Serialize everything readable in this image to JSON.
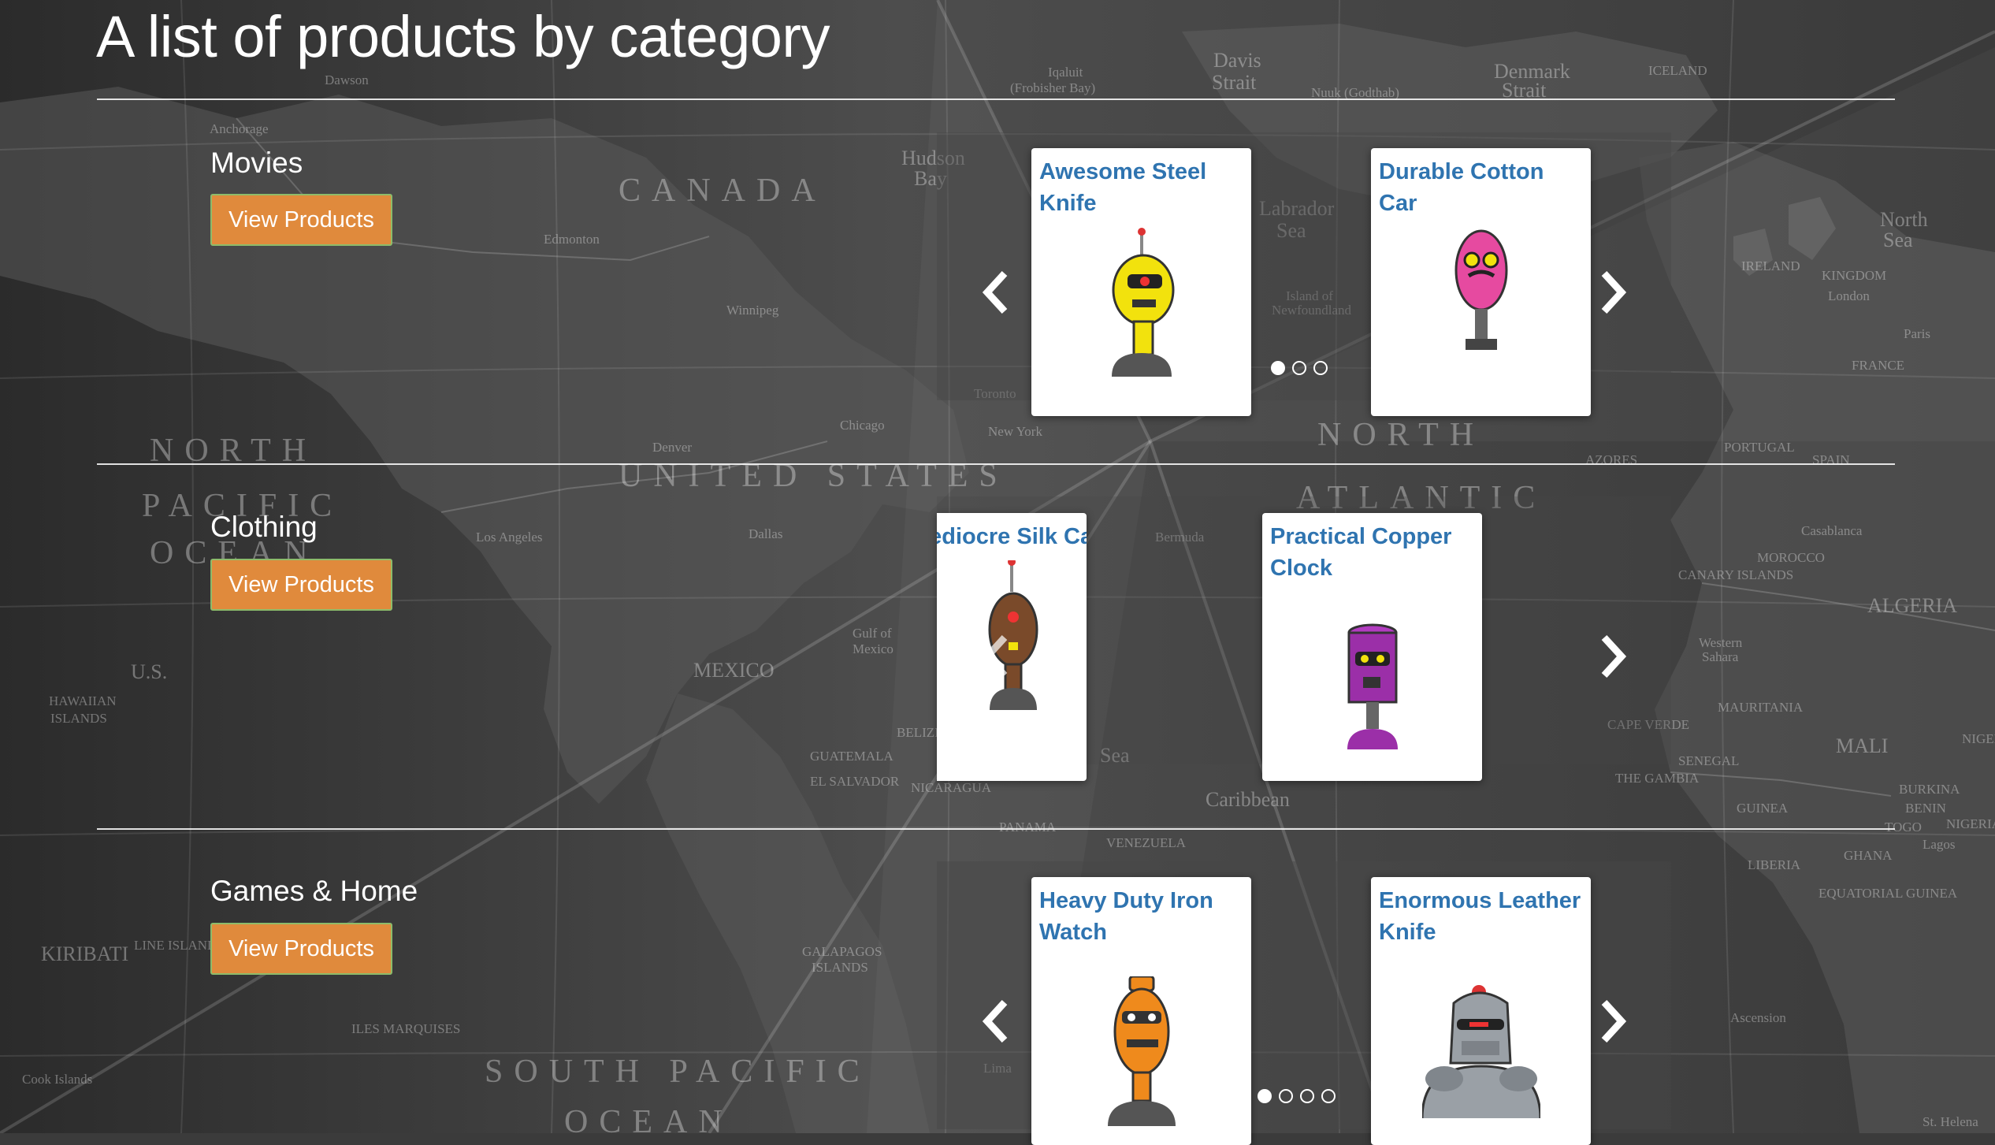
{
  "page": {
    "title": "A list of products by category"
  },
  "map_labels": [
    "CANADA",
    "NORTH",
    "PACIFIC",
    "OCEAN",
    "UNITED STATES",
    "MEXICO",
    "NORTH",
    "ATLANTIC",
    "SOUTH PACIFIC",
    "OCEAN",
    "KIRIBATI",
    "ALGERIA",
    "MALI",
    "MAURITANIA",
    "Labrador",
    "Sea",
    "Hudson",
    "Bay",
    "Davis",
    "Strait",
    "Denmark",
    "Strait",
    "ICELAND",
    "IRELAND",
    "KINGDOM",
    "North",
    "Sea",
    "PORTUGAL",
    "SPAIN",
    "FRANCE",
    "MOROCCO",
    "Casablanca",
    "VENEZUELA",
    "Caribbean",
    "Sea",
    "HAWAIIAN",
    "ISLANDS",
    "U.S.",
    "Los Angeles",
    "Dallas",
    "Chicago",
    "New York",
    "Denver",
    "Winnipeg",
    "Edmonton",
    "Toronto",
    "Anchorage",
    "Dawson",
    "Gulf of",
    "Mexico",
    "EL SALVADOR",
    "NICARAGUA",
    "GUATEMALA",
    "BELIZE",
    "PANAMA",
    "GALAPAGOS",
    "ISLANDS",
    "Lima",
    "ILES MARQUISES",
    "Cook Islands",
    "Bermuda",
    "AZORES",
    "CANARY ISLANDS",
    "CAPE VERDE",
    "THE GAMBIA",
    "SENEGAL",
    "GUINEA",
    "LIBERIA",
    "GHANA",
    "NIGERIA",
    "Lagos",
    "EQUATORIAL GUINEA",
    "Ascension",
    "St. Helena",
    "LINE ISLANDS",
    "Island of",
    "Newfoundland",
    "Western",
    "Sahara",
    "NIGER",
    "BURKINA",
    "BENIN",
    "TOGO",
    "Iqaluit",
    "(Frobisher Bay)",
    "Nuuk (Godthab)",
    "London",
    "Paris"
  ],
  "categories": [
    {
      "name": "Movies",
      "button_label": "View Products",
      "products": [
        {
          "name": "Awesome Steel Knife",
          "robot": "yellow-robot",
          "color": "#f2e20d"
        },
        {
          "name": "Durable Cotton Car",
          "robot": "pink-robot",
          "color": "#e64aa0"
        }
      ],
      "pager": {
        "count": 3,
        "active": 0
      }
    },
    {
      "name": "Clothing",
      "button_label": "View Products",
      "products": [
        {
          "name": "Mediocre Silk Car",
          "robot": "brown-robot",
          "color": "#7a4a2a"
        },
        {
          "name": "Practical Copper Clock",
          "robot": "purple-robot",
          "color": "#9b2fa8"
        }
      ]
    },
    {
      "name": "Games & Home",
      "button_label": "View Products",
      "products": [
        {
          "name": "Heavy Duty Iron Watch",
          "robot": "orange-robot",
          "color": "#ef8a1c"
        },
        {
          "name": "Enormous Leather Knife",
          "robot": "gray-robot",
          "color": "#9aa0a6"
        }
      ],
      "pager": {
        "count": 4,
        "active": 0
      }
    }
  ],
  "icons": {
    "prev": "chevron-left-icon",
    "next": "chevron-right-icon"
  }
}
